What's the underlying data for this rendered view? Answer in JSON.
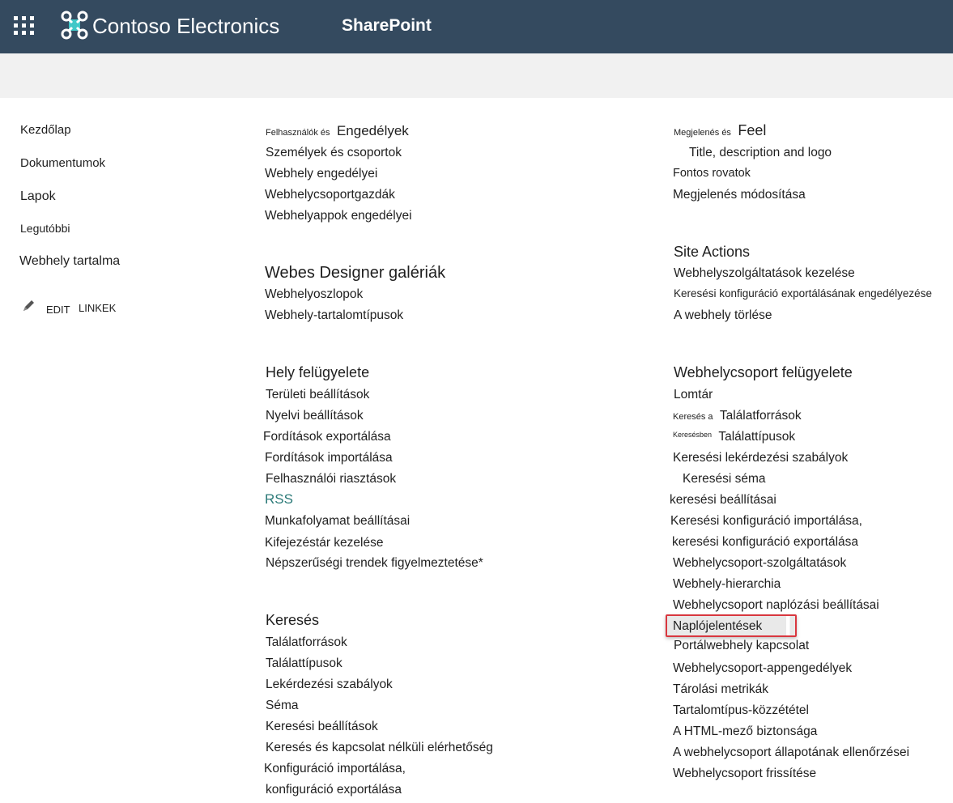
{
  "suitebar": {
    "app_launcher": "app-launcher",
    "brand": "Contoso Electronics",
    "product": "SharePoint",
    "bg_color": "#344a5f"
  },
  "left_nav": {
    "items": [
      "Kezdőlap",
      "Dokumentumok",
      "Lapok",
      "Legutóbbi",
      "Webhely tartalma"
    ],
    "edit_label": "EDIT",
    "links_label": "LINKEK"
  },
  "sections": {
    "users": {
      "heading_prefix": "Felhasználók és",
      "heading": "Engedélyek",
      "links": [
        "Személyek és csoportok",
        "Webhely engedélyei",
        "Webhelycsoportgazdák",
        "Webhelyappok engedélyei"
      ]
    },
    "designer": {
      "heading": "Webes Designer galériák",
      "links": [
        "Webhelyoszlopok",
        "Webhely-tartalomtípusok"
      ]
    },
    "site_admin": {
      "heading": "Hely felügyelete",
      "links": [
        "Területi beállítások",
        "Nyelvi beállítások",
        "Fordítások exportálása",
        "Fordítások importálása",
        "Felhasználói riasztások",
        "RSS",
        "Munkafolyamat beállításai",
        "Kifejezéstár kezelése",
        "Népszerűségi trendek figyelmeztetése*"
      ]
    },
    "search": {
      "heading": "Keresés",
      "links": [
        "Találatforrások",
        "Találattípusok",
        "Lekérdezési szabályok",
        "Séma",
        "Keresési beállítások",
        "Keresés és kapcsolat nélküli elérhetőség",
        "Konfiguráció importálása,",
        "konfiguráció exportálása"
      ]
    },
    "look": {
      "heading_prefix": "Megjelenés és",
      "heading": "Feel",
      "links": [
        "Title, description and logo",
        "Fontos rovatok",
        "Megjelenés módosítása"
      ]
    },
    "site_actions": {
      "heading": "Site Actions",
      "links": [
        "Webhelyszolgáltatások kezelése",
        "Keresési konfiguráció exportálásának engedélyezése",
        "A webhely törlése"
      ]
    },
    "collection_admin": {
      "heading": "Webhelycsoport felügyelete",
      "links": [
        {
          "prefix": "",
          "text": "Lomtár"
        },
        {
          "prefix": "Keresés a",
          "text": "Találatforrások"
        },
        {
          "prefix": "Keresésben",
          "text": "Találattípusok"
        },
        {
          "prefix": "",
          "text": "Keresési lekérdezési szabályok"
        },
        {
          "prefix": "",
          "text": "Keresési séma"
        },
        {
          "prefix": "",
          "text": "keresési beállításai"
        },
        {
          "prefix": "",
          "text": "Keresési konfiguráció importálása,"
        },
        {
          "prefix": "",
          "text": "keresési konfiguráció exportálása"
        },
        {
          "prefix": "",
          "text": "Webhelycsoport-szolgáltatások"
        },
        {
          "prefix": "",
          "text": "Webhely-hierarchia"
        },
        {
          "prefix": "",
          "text": "Webhelycsoport naplózási beállításai"
        },
        {
          "prefix": "",
          "text": "Naplójelentések"
        },
        {
          "prefix": "",
          "text": "Portálwebhely kapcsolat"
        },
        {
          "prefix": "",
          "text": "Webhelycsoport-appengedélyek"
        },
        {
          "prefix": "",
          "text": "Tárolási metrikák"
        },
        {
          "prefix": "",
          "text": "Tartalomtípus-közzététel"
        },
        {
          "prefix": "",
          "text": "A HTML-mező biztonsága"
        },
        {
          "prefix": "",
          "text": "A webhelycsoport állapotának ellenőrzései"
        },
        {
          "prefix": "",
          "text": "Webhelycsoport frissítése"
        }
      ]
    }
  },
  "highlight_color": "#d9373f",
  "rss_color": "#2b7a78"
}
